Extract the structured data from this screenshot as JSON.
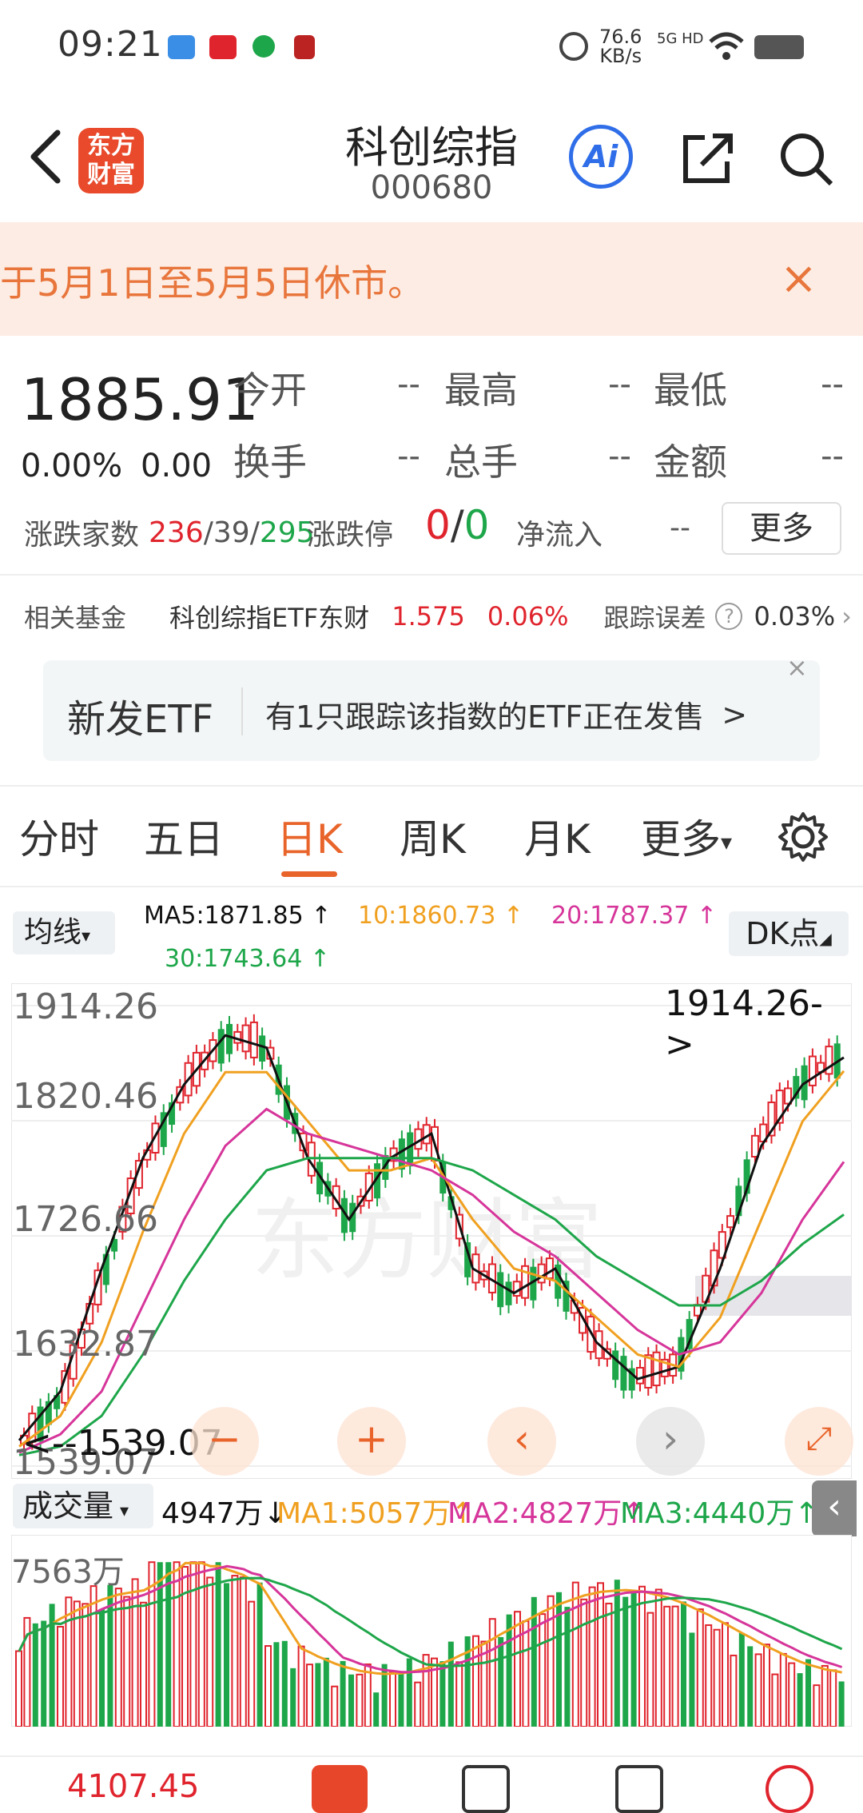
{
  "status_bar": {
    "time": "09:21",
    "net_speed_value": "76.6",
    "net_speed_unit": "KB/s",
    "network": "5G HD"
  },
  "header": {
    "logo_text_1": "东方",
    "logo_text_2": "财富",
    "title": "科创综指",
    "code": "000680",
    "ai_label": "Ai"
  },
  "notice": {
    "text": "于5月1日至5月5日休市。",
    "close": "×"
  },
  "quote": {
    "price": "1885.91",
    "change_pct": "0.00%",
    "change_val": "0.00",
    "fields": [
      {
        "label": "今开",
        "value": "--"
      },
      {
        "label": "最高",
        "value": "--"
      },
      {
        "label": "最低",
        "value": "--"
      },
      {
        "label": "换手",
        "value": "--"
      },
      {
        "label": "总手",
        "value": "--"
      },
      {
        "label": "金额",
        "value": "--"
      }
    ],
    "breadth_label": "涨跌家数",
    "breadth_up": "236",
    "breadth_sep1": "/",
    "breadth_flat": "39",
    "breadth_sep2": "/",
    "breadth_down": "295",
    "limit_label": "涨跌停",
    "limit_up": "0",
    "limit_sep": "/",
    "limit_down": "0",
    "netflow_label": "净流入",
    "netflow_value": "--",
    "more_label": "更多"
  },
  "fund": {
    "label": "相关基金",
    "name": "科创综指ETF东财",
    "price": "1.575",
    "pct": "0.06%",
    "track_label": "跟踪误差",
    "track_value": "0.03%"
  },
  "etf_card": {
    "title": "新发ETF",
    "text": "有1只跟踪该指数的ETF正在发售",
    "arrow": ">",
    "close": "×"
  },
  "tabs": [
    "分时",
    "五日",
    "日K",
    "周K",
    "月K",
    "更多"
  ],
  "ma": {
    "select": "均线",
    "ma5": "MA5:1871.85 ↑",
    "ma10": "10:1860.73 ↑",
    "ma20": "20:1787.37 ↑",
    "ma30": "30:1743.64 ↑",
    "dk": "DK点"
  },
  "chart_labels": {
    "y_top": "1914.26",
    "y_2": "1820.46",
    "y_3": "1726.66",
    "y_4": "1632.87",
    "y_bottom": "1539.07",
    "high_marker": "1914.26->",
    "low_marker": "<--1539.07",
    "watermark": "东方财富"
  },
  "volume": {
    "select": "成交量",
    "current": "4947万↓",
    "ma1": "MA1:5057万↑",
    "ma2": "MA2:4827万↑",
    "ma3": "MA3:4440万↑",
    "y_top": "7563万"
  },
  "chart_data": {
    "type": "line",
    "title": "科创综指 日K",
    "ylim": [
      1539.07,
      1914.26
    ],
    "yticks": [
      1914.26,
      1820.46,
      1726.66,
      1632.87,
      1539.07
    ],
    "series": [
      {
        "name": "MA5",
        "values": [
          1560,
          1600,
          1700,
          1790,
          1850,
          1890,
          1880,
          1790,
          1740,
          1790,
          1810,
          1700,
          1680,
          1700,
          1640,
          1610,
          1620,
          1700,
          1800,
          1850,
          1872
        ]
      },
      {
        "name": "MA10",
        "values": [
          1555,
          1580,
          1640,
          1730,
          1810,
          1860,
          1860,
          1820,
          1780,
          1780,
          1790,
          1740,
          1700,
          1690,
          1660,
          1630,
          1620,
          1660,
          1740,
          1820,
          1861
        ]
      },
      {
        "name": "MA20",
        "values": [
          1550,
          1565,
          1600,
          1670,
          1740,
          1800,
          1830,
          1810,
          1800,
          1790,
          1780,
          1760,
          1730,
          1710,
          1680,
          1650,
          1630,
          1640,
          1680,
          1740,
          1787
        ]
      },
      {
        "name": "MA30",
        "values": [
          1548,
          1555,
          1580,
          1630,
          1690,
          1740,
          1780,
          1790,
          1790,
          1790,
          1790,
          1780,
          1760,
          1740,
          1710,
          1690,
          1670,
          1670,
          1690,
          1720,
          1744
        ]
      }
    ]
  },
  "bottom": {
    "value": "4107.45"
  },
  "colors": {
    "up": "#e0242d",
    "down": "#1ea64a",
    "accent": "#e8642a",
    "ma5": "#111111",
    "ma10": "#f0a020",
    "ma20": "#d6359a",
    "ma30": "#1ea64a"
  }
}
